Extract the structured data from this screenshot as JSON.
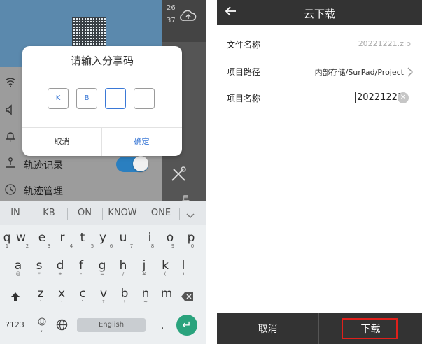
{
  "left_app": {
    "right_strip_numbers": [
      "26",
      "37"
    ],
    "tools_label": "工具",
    "list_items": [
      "轨迹记录",
      "轨迹管理"
    ],
    "icons": [
      "cloud-icon",
      "wifi-icon",
      "volume-icon",
      "alarm-icon",
      "track-record-icon",
      "track-manage-icon",
      "tools-icon"
    ],
    "toggle_state": "on",
    "accent_color": "#2a7fc0"
  },
  "share_dialog": {
    "title": "请输入分享码",
    "code_boxes": [
      "K",
      "B",
      "",
      ""
    ],
    "cancel_label": "取消",
    "confirm_label": "确定",
    "confirm_color": "#3a78d6"
  },
  "keyboard": {
    "suggestions": [
      "IN",
      "KB",
      "ON",
      "KNOW",
      "ONE"
    ],
    "expand_icon": "chevron-down-icon",
    "row1": [
      "q",
      "w",
      "e",
      "r",
      "t",
      "y",
      "u",
      "i",
      "o",
      "p"
    ],
    "row1_sub": [
      "1",
      "2",
      "3",
      "4",
      "5",
      "6",
      "7",
      "8",
      "9",
      "0"
    ],
    "row2": [
      "a",
      "s",
      "d",
      "f",
      "g",
      "h",
      "j",
      "k",
      "l"
    ],
    "row2_sub": [
      "@",
      "*",
      "+",
      "-",
      "=",
      "/",
      "#",
      "(",
      ")"
    ],
    "row3": [
      "z",
      "x",
      "c",
      "v",
      "b",
      "n",
      "m"
    ],
    "row3_sub": [
      "'",
      ":",
      "\"",
      "?",
      "!",
      "~",
      "…"
    ],
    "symbols_label": "?123",
    "emoji_sub": ",",
    "space_label": "English",
    "period_label": ".",
    "enter_color": "#2aa37d"
  },
  "cloud_download": {
    "title": "云下载",
    "rows": [
      {
        "label": "文件名称",
        "value": "20221221.zip"
      },
      {
        "label": "项目路径",
        "value": "内部存储/SurPad/Project"
      },
      {
        "label": "项目名称",
        "value": "20221221"
      }
    ],
    "cancel_label": "取消",
    "download_label": "下载",
    "highlight_color": "#e0201b"
  }
}
